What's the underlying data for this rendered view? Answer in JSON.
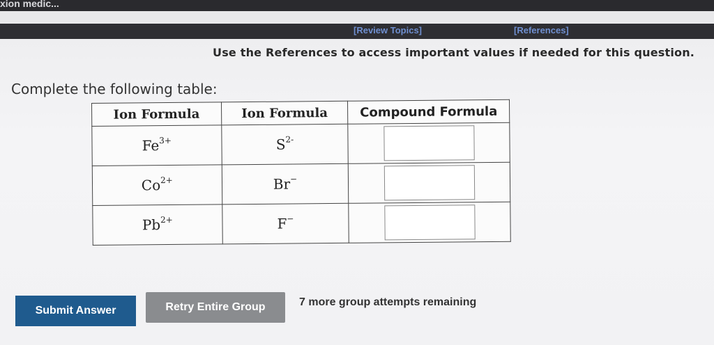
{
  "window": {
    "title_fragment": "xion medic..."
  },
  "references_bar": {
    "review_topics": "[Review Topics]",
    "references": "[References]"
  },
  "notice": "Use the References to access important values if needed for this question.",
  "prompt": "Complete the following table:",
  "table": {
    "headers": [
      "Ion Formula",
      "Ion Formula",
      "Compound Formula"
    ],
    "rows": [
      {
        "cation_base": "Fe",
        "cation_charge": "3+",
        "anion_base": "S",
        "anion_charge": "2-",
        "answer": ""
      },
      {
        "cation_base": "Co",
        "cation_charge": "2+",
        "anion_base": "Br",
        "anion_charge": "−",
        "answer": ""
      },
      {
        "cation_base": "Pb",
        "cation_charge": "2+",
        "anion_base": "F",
        "anion_charge": "−",
        "answer": ""
      }
    ]
  },
  "buttons": {
    "submit": "Submit Answer",
    "retry": "Retry Entire Group"
  },
  "attempts_text": "7 more group attempts remaining"
}
